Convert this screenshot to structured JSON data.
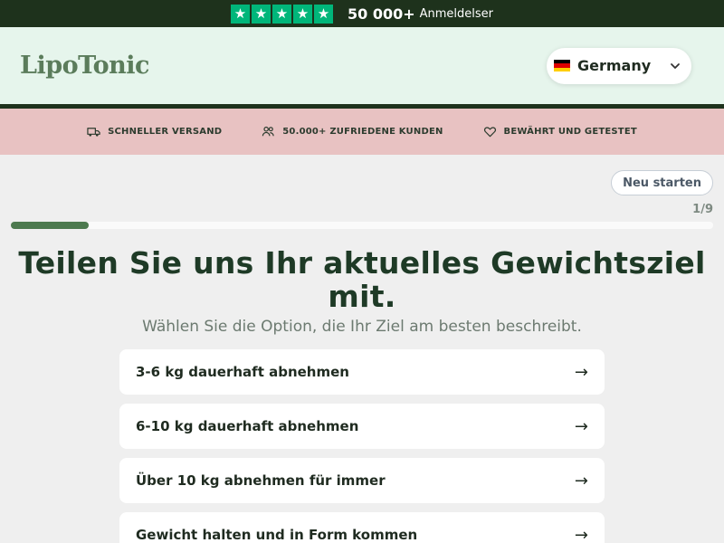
{
  "topbar": {
    "rating_count": "50 000+",
    "rating_text": "Anmeldelser",
    "star_color": "#00b67a",
    "stars": 5
  },
  "header": {
    "logo": "LipoTonic",
    "country": "Germany",
    "flag_colors": [
      "#000000",
      "#dd0000",
      "#ffce00"
    ]
  },
  "usp": [
    {
      "icon": "truck-icon",
      "label": "SCHNELLER VERSAND"
    },
    {
      "icon": "users-icon",
      "label": "50.000+ ZUFRIEDENE KUNDEN"
    },
    {
      "icon": "heart-icon",
      "label": "BEWÄHRT UND GETESTET"
    }
  ],
  "quiz": {
    "restart_label": "Neu starten",
    "step": "1/9",
    "progress_fraction": 0.111,
    "question": "Teilen Sie uns Ihr aktuelles Gewichtsziel mit.",
    "subtitle": "Wählen Sie die Option, die Ihr Ziel am besten beschreibt.",
    "options": [
      {
        "label": "3-6 kg dauerhaft abnehmen",
        "arrow": "→"
      },
      {
        "label": "6-10 kg dauerhaft abnehmen",
        "arrow": "→"
      },
      {
        "label": "Über 10 kg abnehmen für immer",
        "arrow": "→"
      },
      {
        "label": "Gewicht halten und in Form kommen",
        "arrow": "→"
      }
    ]
  },
  "colors": {
    "topbar_bg": "#1e321c",
    "header_bg": "#e6f5ec",
    "usp_bg": "#e8c2c2",
    "accent": "#4d7a4f"
  }
}
